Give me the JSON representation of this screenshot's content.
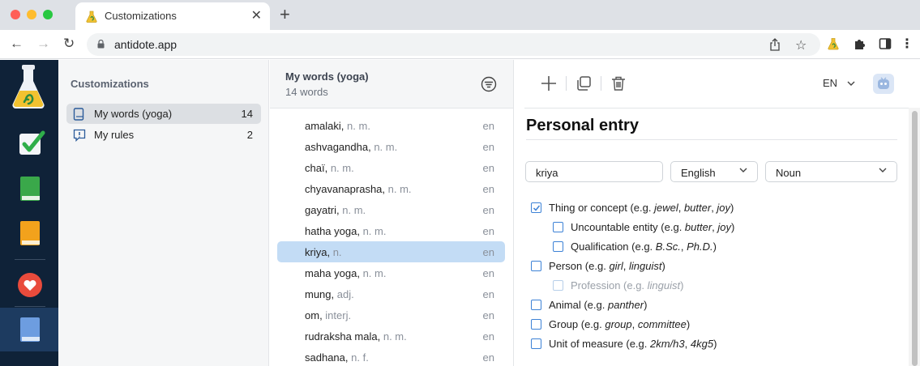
{
  "browser": {
    "tab_title": "Customizations",
    "url": "antidote.app",
    "traffic_light_colors": [
      "#ff5f57",
      "#febc2e",
      "#28c840"
    ]
  },
  "sidebar": {
    "title": "Customizations",
    "items": [
      {
        "label": "My words (yoga)",
        "count": "14",
        "icon": "book-icon",
        "active": true
      },
      {
        "label": "My rules",
        "count": "2",
        "icon": "rule-alert-icon",
        "active": false
      }
    ]
  },
  "wordlist": {
    "title": "My words (yoga)",
    "subtitle": "14 words",
    "words": [
      {
        "word": "amalaki",
        "pos": "n. m.",
        "lang": "en",
        "selected": false
      },
      {
        "word": "ashvagandha",
        "pos": "n. m.",
        "lang": "en",
        "selected": false
      },
      {
        "word": "chaï",
        "pos": "n. m.",
        "lang": "en",
        "selected": false
      },
      {
        "word": "chyavanaprasha",
        "pos": "n. m.",
        "lang": "en",
        "selected": false
      },
      {
        "word": "gayatri",
        "pos": "n. m.",
        "lang": "en",
        "selected": false
      },
      {
        "word": "hatha yoga",
        "pos": "n. m.",
        "lang": "en",
        "selected": false
      },
      {
        "word": "kriya",
        "pos": "n.",
        "lang": "en",
        "selected": true
      },
      {
        "word": "maha yoga",
        "pos": "n. m.",
        "lang": "en",
        "selected": false
      },
      {
        "word": "mung",
        "pos": "adj.",
        "lang": "en",
        "selected": false
      },
      {
        "word": "om",
        "pos": "interj.",
        "lang": "en",
        "selected": false
      },
      {
        "word": "rudraksha mala",
        "pos": "n. m.",
        "lang": "en",
        "selected": false
      },
      {
        "word": "sadhana",
        "pos": "n. f.",
        "lang": "en",
        "selected": false
      }
    ]
  },
  "detail": {
    "language_code": "EN",
    "entry_title": "Personal entry",
    "word_value": "kriya",
    "language_value": "English",
    "pos_value": "Noun",
    "accent_color": "#3d82d6",
    "categories": [
      {
        "parts": [
          [
            "Thing or concept (e.g. ",
            false
          ],
          [
            "jewel",
            true
          ],
          [
            ", ",
            false
          ],
          [
            "butter",
            true
          ],
          [
            ", ",
            false
          ],
          [
            "joy",
            true
          ],
          [
            ")",
            false
          ]
        ],
        "checked": true,
        "indent": 0,
        "dim": false
      },
      {
        "parts": [
          [
            "Uncountable entity (e.g. ",
            false
          ],
          [
            "butter",
            true
          ],
          [
            ", ",
            false
          ],
          [
            "joy",
            true
          ],
          [
            ")",
            false
          ]
        ],
        "checked": false,
        "indent": 1,
        "dim": false
      },
      {
        "parts": [
          [
            "Qualification (e.g. ",
            false
          ],
          [
            "B.Sc.",
            true
          ],
          [
            ", ",
            false
          ],
          [
            "Ph.D.",
            true
          ],
          [
            ")",
            false
          ]
        ],
        "checked": false,
        "indent": 1,
        "dim": false
      },
      {
        "parts": [
          [
            "Person (e.g. ",
            false
          ],
          [
            "girl",
            true
          ],
          [
            ", ",
            false
          ],
          [
            "linguist",
            true
          ],
          [
            ")",
            false
          ]
        ],
        "checked": false,
        "indent": 0,
        "dim": false
      },
      {
        "parts": [
          [
            "Profession (e.g. ",
            false
          ],
          [
            "linguist",
            true
          ],
          [
            ")",
            false
          ]
        ],
        "checked": false,
        "indent": 1,
        "dim": true
      },
      {
        "parts": [
          [
            "Animal (e.g. ",
            false
          ],
          [
            "panther",
            true
          ],
          [
            ")",
            false
          ]
        ],
        "checked": false,
        "indent": 0,
        "dim": false
      },
      {
        "parts": [
          [
            "Group (e.g. ",
            false
          ],
          [
            "group",
            true
          ],
          [
            ", ",
            false
          ],
          [
            "committee",
            true
          ],
          [
            ")",
            false
          ]
        ],
        "checked": false,
        "indent": 0,
        "dim": false
      },
      {
        "parts": [
          [
            "Unit of measure (e.g. ",
            false
          ],
          [
            "2km/h3",
            true
          ],
          [
            ", ",
            false
          ],
          [
            "4kg5",
            true
          ],
          [
            ")",
            false
          ]
        ],
        "checked": false,
        "indent": 0,
        "dim": false
      }
    ]
  }
}
